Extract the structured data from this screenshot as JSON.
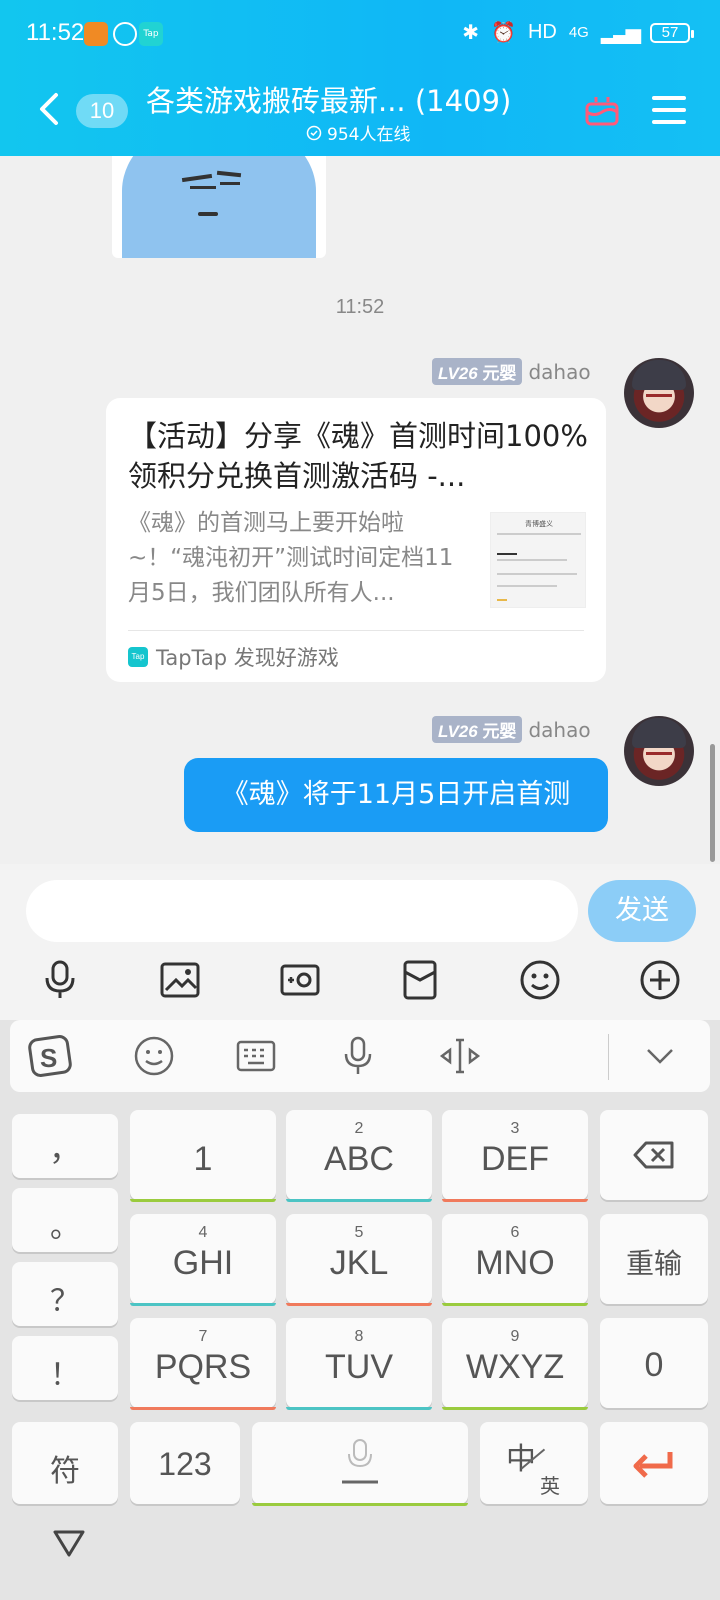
{
  "status_bar": {
    "time": "11:52",
    "network": "HD",
    "signal": "4G",
    "battery": "57"
  },
  "header": {
    "unread_badge": "10",
    "group_title": "各类游戏搬砖最新... (1409)",
    "online_count": "954人在线"
  },
  "chat": {
    "timestamp": "11:52",
    "messages": [
      {
        "level": "LV26",
        "rank": "元婴",
        "sender": "dahao",
        "card": {
          "title": "【活动】分享《魂》首测时间100%领积分兑换首测激活码 -...",
          "description": "《魂》的首测马上要开始啦~！“魂沌初开”测试时间定档11月5日，我们团队所有人...",
          "thumb_title": "青博盛义",
          "source": "TapTap 发现好游戏"
        }
      },
      {
        "level": "LV26",
        "rank": "元婴",
        "sender": "dahao",
        "text": "《魂》将于11月5日开启首测"
      }
    ]
  },
  "composer": {
    "input_placeholder": "",
    "send_label": "发送"
  },
  "keyboard": {
    "punct": [
      "，",
      "。",
      "？",
      "！"
    ],
    "row1": [
      {
        "sub": "",
        "main": "1"
      },
      {
        "sub": "2",
        "main": "ABC"
      },
      {
        "sub": "3",
        "main": "DEF"
      }
    ],
    "row2": [
      {
        "sub": "4",
        "main": "GHI"
      },
      {
        "sub": "5",
        "main": "JKL"
      },
      {
        "sub": "6",
        "main": "MNO"
      }
    ],
    "row3": [
      {
        "sub": "7",
        "main": "PQRS"
      },
      {
        "sub": "8",
        "main": "TUV"
      },
      {
        "sub": "9",
        "main": "WXYZ"
      }
    ],
    "reset_label": "重输",
    "zero_label": "0",
    "symbol_label": "符",
    "num_label": "123",
    "lang_main": "中",
    "lang_sub": "英"
  },
  "colors": {
    "header_gradient": "#12c6ef",
    "bubble_blue": "#1a9cf5",
    "send_button": "#8ccdf7"
  }
}
